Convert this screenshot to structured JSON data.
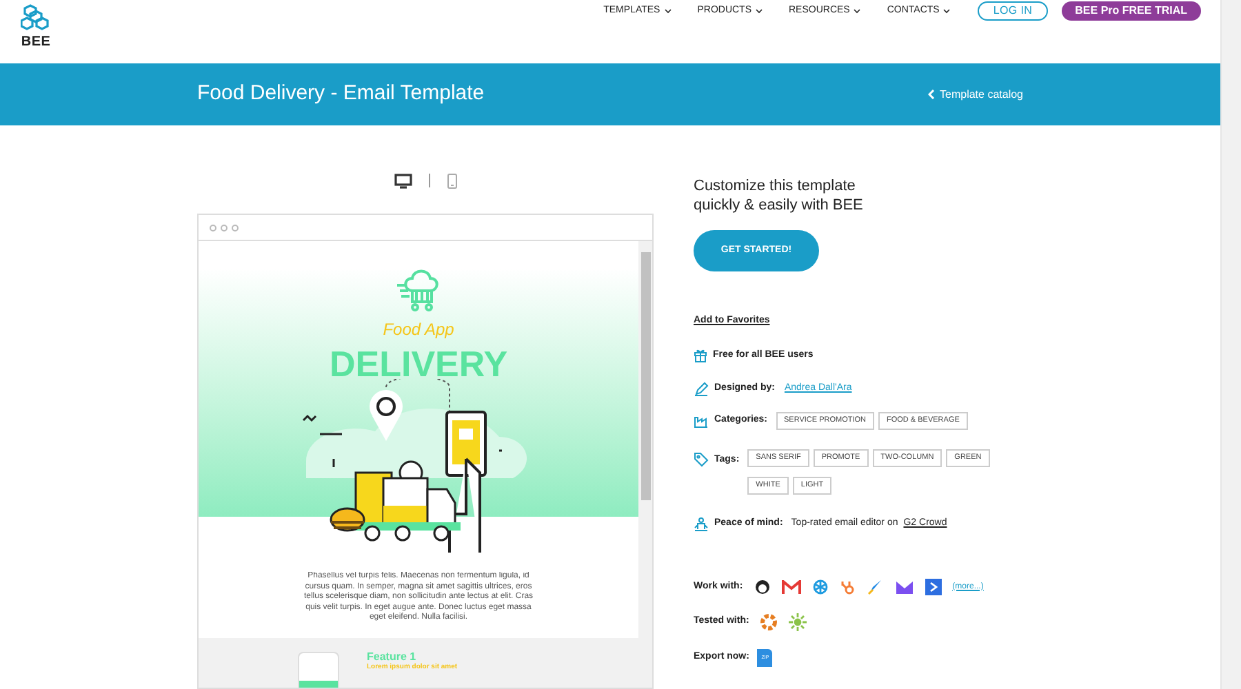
{
  "header": {
    "logo": "BEE",
    "nav": [
      {
        "label": "TEMPLATES"
      },
      {
        "label": "PRODUCTS"
      },
      {
        "label": "RESOURCES"
      },
      {
        "label": "CONTACTS"
      }
    ],
    "login": "LOG IN",
    "trial": "BEE Pro FREE TRIAL"
  },
  "banner": {
    "title": "Food Delivery - Email Template",
    "back_link": "Template catalog"
  },
  "preview": {
    "devices": [
      {
        "kind": "desktop",
        "selected": true
      },
      {
        "kind": "mobile",
        "selected": false
      }
    ],
    "email": {
      "subtitle": "Food App",
      "headline": "DELIVERY",
      "body": "Phasellus vel turpis felis. Maecenas non fermentum ligula, id cursus quam. In semper, magna sit amet sagittis ultrices, eros tellus scelerisque diam, non sollicitudin ante lectus at elit. Cras quis velit turpis. In eget augue ante. Donec luctus eget massa eget eleifend. Nulla facilisi.",
      "feature_title": "Feature 1",
      "feature_subtitle": "Lorem ipsum dolor sit amet"
    }
  },
  "details": {
    "heading": "Customize this template\nquickly & easily with BEE",
    "cta": "GET STARTED!",
    "favorites": "Add to Favorites",
    "free": "Free for all BEE users",
    "designed_by": {
      "label": "Designed by:",
      "name": "Andrea Dall'Ara"
    },
    "categories": {
      "label": "Categories:",
      "items": [
        "SERVICE PROMOTION",
        "FOOD & BEVERAGE"
      ]
    },
    "tags": {
      "label": "Tags:",
      "items": [
        "SANS SERIF",
        "PROMOTE",
        "TWO-COLUMN",
        "GREEN",
        "WHITE",
        "LIGHT"
      ]
    },
    "peace": {
      "label": "Peace of mind:",
      "text": "Top-rated email editor on",
      "link": "G2 Crowd"
    },
    "work_with": {
      "label": "Work with:",
      "more": "(more...)"
    },
    "tested_with": {
      "label": "Tested with:"
    },
    "export": {
      "label": "Export now:",
      "file": "ZIP"
    }
  }
}
